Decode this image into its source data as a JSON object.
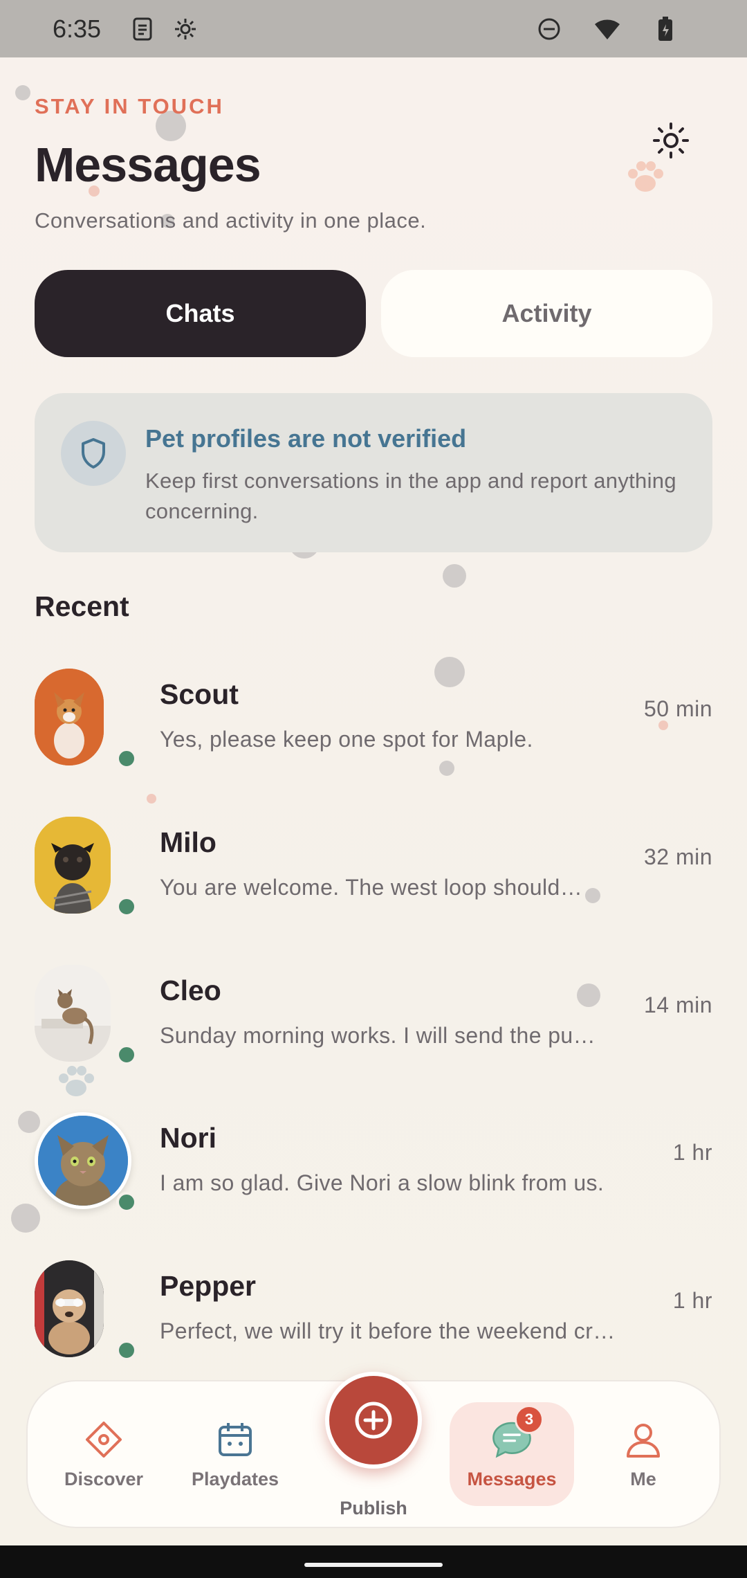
{
  "status_bar": {
    "time": "6:35"
  },
  "header": {
    "eyebrow": "STAY IN TOUCH",
    "title": "Messages",
    "subtitle": "Conversations and activity in one place."
  },
  "tabs": [
    {
      "label": "Chats",
      "active": true
    },
    {
      "label": "Activity",
      "active": false
    }
  ],
  "notice": {
    "title": "Pet profiles are not verified",
    "body": "Keep first conversations in the app and report anything concerning."
  },
  "recent": {
    "heading": "Recent",
    "chats": [
      {
        "name": "Scout",
        "preview": "Yes, please keep one spot for Maple.",
        "time": "50 min"
      },
      {
        "name": "Milo",
        "preview": "You are welcome. The west loop should…",
        "time": "32 min"
      },
      {
        "name": "Cleo",
        "preview": "Sunday morning works. I will send the pu…",
        "time": "14 min"
      },
      {
        "name": "Nori",
        "preview": "I am so glad. Give Nori a slow blink from us.",
        "time": "1 hr"
      },
      {
        "name": "Pepper",
        "preview": "Perfect, we will try it before the weekend cr…",
        "time": "1 hr"
      }
    ]
  },
  "bottom_nav": {
    "items": [
      {
        "label": "Discover"
      },
      {
        "label": "Playdates"
      },
      {
        "label": "Publish"
      },
      {
        "label": "Messages",
        "badge": "3",
        "active": true
      },
      {
        "label": "Me"
      }
    ]
  },
  "colors": {
    "accent": "#e07058",
    "dark": "#2a2329",
    "info": "#467592",
    "online": "#4a8a6b",
    "publish": "#b9483b"
  }
}
